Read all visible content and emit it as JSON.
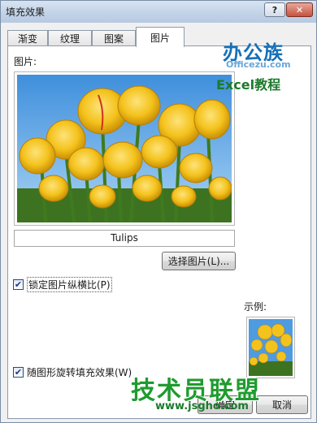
{
  "window": {
    "title": "填充效果",
    "help_label": "?",
    "close_label": "✕"
  },
  "tabs": [
    {
      "label": "渐变"
    },
    {
      "label": "纹理"
    },
    {
      "label": "图案"
    },
    {
      "label": "图片"
    }
  ],
  "panel": {
    "picture_label": "图片:",
    "picture_name": "Tulips",
    "select_button": "选择图片(L)...",
    "lock_ratio_label": "锁定图片纵横比(P)",
    "rotate_label": "随图形旋转填充效果(W)",
    "preview_label": "示例:",
    "ok_button": "确定",
    "cancel_button": "取消"
  },
  "watermark": {
    "logo": "办公族",
    "site": "Officezu.com",
    "excel": "Excel教程",
    "brand": "技术员联盟",
    "url": "www.jsgho.com"
  },
  "colors": {
    "sky": "#4f9be0",
    "tulip": "#f4c21c",
    "stem": "#3f7a1e"
  }
}
